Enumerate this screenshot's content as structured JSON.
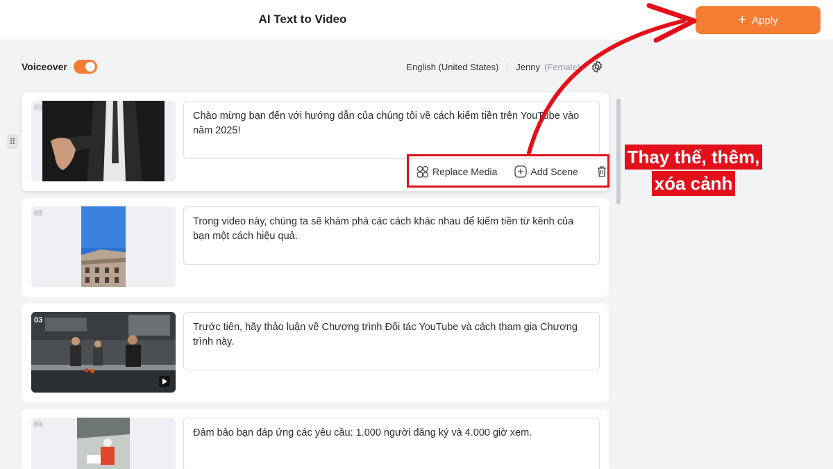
{
  "header": {
    "title": "AI Text to Video",
    "apply_label": "Apply"
  },
  "voiceover": {
    "label": "Voiceover",
    "enabled": true
  },
  "voice": {
    "language": "English (United States)",
    "name": "Jenny",
    "gender": "(Female)"
  },
  "scenes": [
    {
      "number": "01",
      "text": "Chào mừng bạn đến với hướng dẫn của chúng tôi về cách kiếm tiền trên YouTube vào năm 2025!",
      "media_type": "image"
    },
    {
      "number": "02",
      "text": "Trong video này, chúng ta sẽ khám phá các cách khác nhau để kiếm tiền từ kênh của bạn một cách hiệu quả.",
      "media_type": "image"
    },
    {
      "number": "03",
      "text": "Trước tiên, hãy thảo luận về Chương trình Đối tác YouTube và cách tham gia Chương trình này.",
      "media_type": "video"
    },
    {
      "number": "04",
      "text": "Đảm bảo bạn đáp ứng các yêu cầu: 1.000 người đăng ký và 4.000 giờ xem.",
      "media_type": "image"
    }
  ],
  "scene_actions": {
    "replace_media": "Replace Media",
    "add_scene": "Add Scene"
  },
  "annotation": {
    "line1": "Thay thế, thêm,",
    "line2": "xóa cảnh"
  },
  "colors": {
    "accent": "#f47c33",
    "annotation_red": "#e3101c"
  }
}
